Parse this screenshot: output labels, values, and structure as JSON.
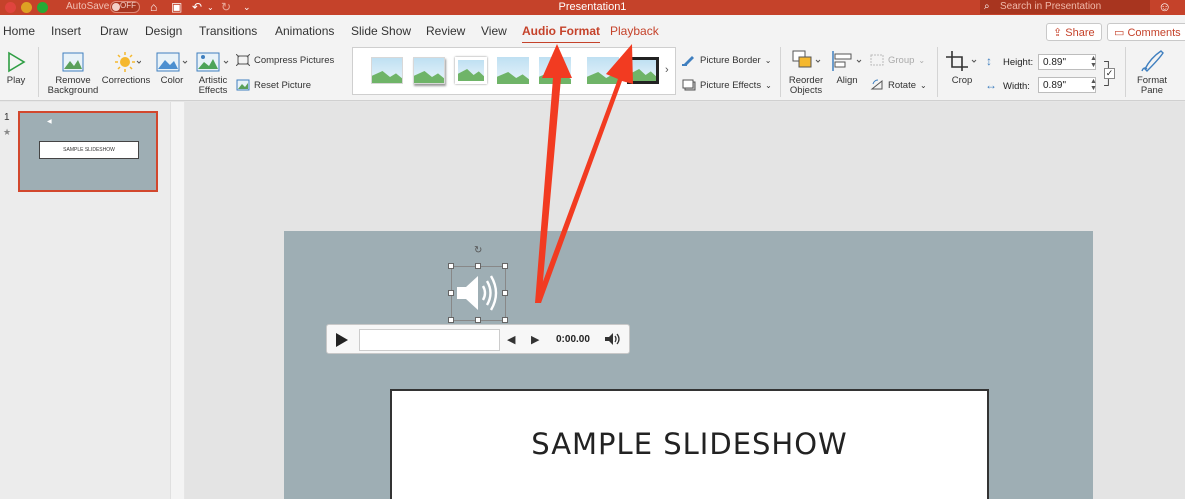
{
  "titlebar": {
    "autosave_label": "AutoSave",
    "autosave_state": "OFF",
    "doc_title": "Presentation1",
    "search_placeholder": "Search in Presentation"
  },
  "tabs": [
    {
      "label": "Home"
    },
    {
      "label": "Insert"
    },
    {
      "label": "Draw"
    },
    {
      "label": "Design"
    },
    {
      "label": "Transitions"
    },
    {
      "label": "Animations"
    },
    {
      "label": "Slide Show"
    },
    {
      "label": "Review"
    },
    {
      "label": "View"
    },
    {
      "label": "Audio Format",
      "active": true
    },
    {
      "label": "Playback"
    }
  ],
  "header_buttons": {
    "share": "Share",
    "comments": "Comments"
  },
  "ribbon": {
    "play": "Play",
    "remove_background_1": "Remove",
    "remove_background_2": "Background",
    "corrections": "Corrections",
    "color": "Color",
    "artistic_1": "Artistic",
    "artistic_2": "Effects",
    "compress": "Compress Pictures",
    "reset": "Reset Picture",
    "picture_border": "Picture Border",
    "picture_effects": "Picture Effects",
    "reorder_1": "Reorder",
    "reorder_2": "Objects",
    "align": "Align",
    "group": "Group",
    "rotate": "Rotate",
    "crop": "Crop",
    "height_label": "Height:",
    "height_value": "0.89\"",
    "width_label": "Width:",
    "width_value": "0.89\"",
    "format_pane_1": "Format",
    "format_pane_2": "Pane"
  },
  "slides_pane": {
    "slide_number": "1",
    "thumb_title": "SAMPLE SLIDESHOW"
  },
  "slide": {
    "title": "SAMPLE SLIDESHOW",
    "player_time": "0:00.00"
  },
  "colors": {
    "accent": "#c5422a",
    "annotation_arrow": "#f23b21",
    "slide_bg": "#9eaeb4"
  }
}
